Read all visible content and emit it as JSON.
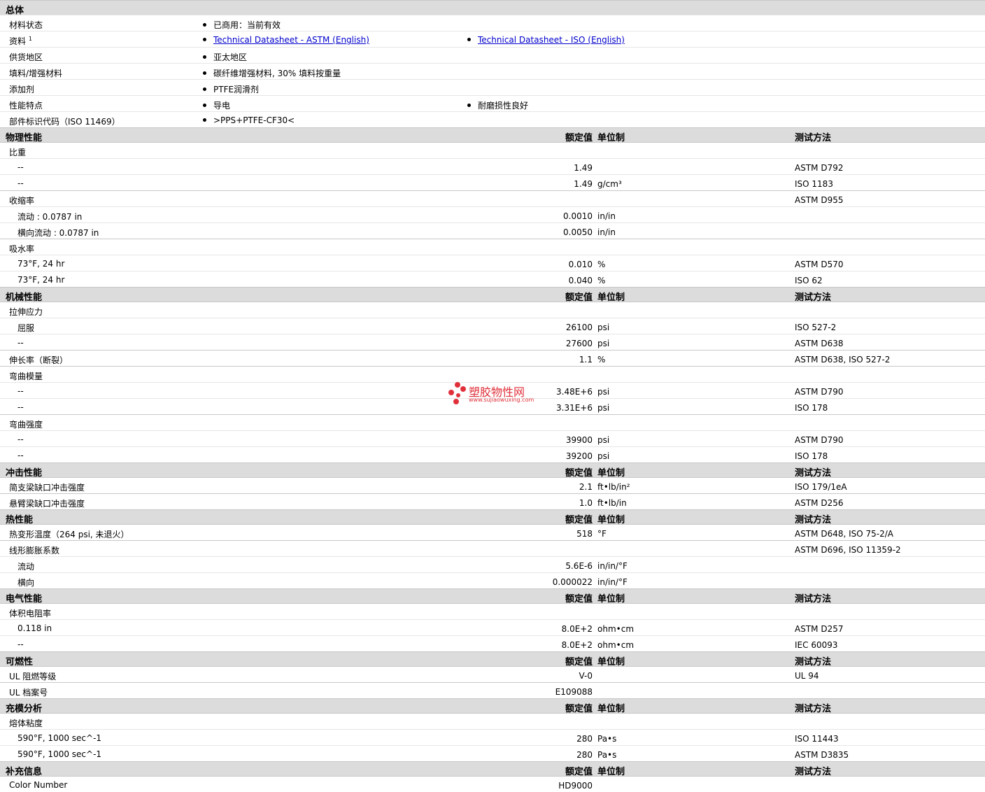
{
  "general": {
    "title": "总体",
    "rows": [
      {
        "label": "材料状态",
        "items": [
          "已商用：当前有效"
        ]
      },
      {
        "label": "资料",
        "sup": "1",
        "items": [
          "Technical Datasheet - ASTM (English)",
          "Technical Datasheet - ISO (English)"
        ],
        "links": true
      },
      {
        "label": "供货地区",
        "items": [
          "亚太地区"
        ]
      },
      {
        "label": "填料/增强材料",
        "items": [
          "碳纤维增强材料, 30% 填料按重量"
        ]
      },
      {
        "label": "添加剂",
        "items": [
          "PTFE润滑剂"
        ]
      },
      {
        "label": "性能特点",
        "items": [
          "导电",
          "耐磨损性良好"
        ]
      },
      {
        "label": "部件标识代码（ISO 11469）",
        "items": [
          ">PPS+PTFE-CF30<"
        ]
      }
    ]
  },
  "column_headers": {
    "value": "额定值",
    "unit": "单位制",
    "method": "测试方法"
  },
  "sections": [
    {
      "title": "物理性能",
      "rows": [
        {
          "type": "grp",
          "label": "比重",
          "value": "",
          "unit": "",
          "method": ""
        },
        {
          "type": "sub",
          "label": "--",
          "value": "1.49",
          "unit": "",
          "method": "ASTM D792"
        },
        {
          "type": "sub",
          "label": "--",
          "value": "1.49",
          "unit": "g/cm³",
          "method": "ISO 1183"
        },
        {
          "type": "grp",
          "label": "收缩率",
          "value": "",
          "unit": "",
          "method": "ASTM D955"
        },
        {
          "type": "sub",
          "label": "流动 : 0.0787 in",
          "value": "0.0010",
          "unit": "in/in",
          "method": ""
        },
        {
          "type": "sub",
          "label": "横向流动 : 0.0787 in",
          "value": "0.0050",
          "unit": "in/in",
          "method": ""
        },
        {
          "type": "grp",
          "label": "吸水率",
          "value": "",
          "unit": "",
          "method": ""
        },
        {
          "type": "sub",
          "label": "73°F, 24 hr",
          "value": "0.010",
          "unit": "%",
          "method": "ASTM D570"
        },
        {
          "type": "sub",
          "label": "73°F, 24 hr",
          "value": "0.040",
          "unit": "%",
          "method": "ISO 62"
        }
      ]
    },
    {
      "title": "机械性能",
      "rows": [
        {
          "type": "grp",
          "label": "拉伸应力",
          "value": "",
          "unit": "",
          "method": ""
        },
        {
          "type": "sub",
          "label": "屈服",
          "value": "26100",
          "unit": "psi",
          "method": "ISO 527-2"
        },
        {
          "type": "sub",
          "label": "--",
          "value": "27600",
          "unit": "psi",
          "method": "ASTM D638"
        },
        {
          "type": "grp",
          "label": "伸长率（断裂）",
          "value": "1.1",
          "unit": "%",
          "method": "ASTM D638, ISO 527-2"
        },
        {
          "type": "grp",
          "label": "弯曲模量",
          "value": "",
          "unit": "",
          "method": ""
        },
        {
          "type": "sub",
          "label": "--",
          "value": "3.48E+6",
          "unit": "psi",
          "method": "ASTM D790"
        },
        {
          "type": "sub",
          "label": "--",
          "value": "3.31E+6",
          "unit": "psi",
          "method": "ISO 178"
        },
        {
          "type": "grp",
          "label": "弯曲强度",
          "value": "",
          "unit": "",
          "method": ""
        },
        {
          "type": "sub",
          "label": "--",
          "value": "39900",
          "unit": "psi",
          "method": "ASTM D790"
        },
        {
          "type": "sub",
          "label": "--",
          "value": "39200",
          "unit": "psi",
          "method": "ISO 178"
        }
      ]
    },
    {
      "title": "冲击性能",
      "rows": [
        {
          "type": "grp",
          "label": "简支梁缺口冲击强度",
          "value": "2.1",
          "unit": "ft•lb/in²",
          "method": "ISO 179/1eA"
        },
        {
          "type": "grp",
          "label": "悬臂梁缺口冲击强度",
          "value": "1.0",
          "unit": "ft•lb/in",
          "method": "ASTM D256"
        }
      ]
    },
    {
      "title": "热性能",
      "rows": [
        {
          "type": "grp",
          "label": "热变形温度（264 psi, 未退火）",
          "value": "518",
          "unit": "°F",
          "method": "ASTM D648, ISO 75-2/A"
        },
        {
          "type": "grp",
          "label": "线形膨胀系数",
          "value": "",
          "unit": "",
          "method": "ASTM D696, ISO 11359-2"
        },
        {
          "type": "sub",
          "label": "流动",
          "value": "5.6E-6",
          "unit": "in/in/°F",
          "method": ""
        },
        {
          "type": "sub",
          "label": "横向",
          "value": "0.000022",
          "unit": "in/in/°F",
          "method": ""
        }
      ]
    },
    {
      "title": "电气性能",
      "rows": [
        {
          "type": "grp",
          "label": "体积电阻率",
          "value": "",
          "unit": "",
          "method": ""
        },
        {
          "type": "sub",
          "label": "0.118 in",
          "value": "8.0E+2",
          "unit": "ohm•cm",
          "method": "ASTM D257"
        },
        {
          "type": "sub",
          "label": "--",
          "value": "8.0E+2",
          "unit": "ohm•cm",
          "method": "IEC 60093"
        }
      ]
    },
    {
      "title": "可燃性",
      "rows": [
        {
          "type": "grp",
          "label": "UL 阻燃等级",
          "value": "V-0",
          "unit": "",
          "method": "UL 94"
        },
        {
          "type": "grp",
          "label": "UL 档案号",
          "value": "E109088",
          "unit": "",
          "method": ""
        }
      ]
    },
    {
      "title": "充模分析",
      "rows": [
        {
          "type": "grp",
          "label": "熔体粘度",
          "value": "",
          "unit": "",
          "method": ""
        },
        {
          "type": "sub",
          "label": "590°F, 1000 sec^-1",
          "value": "280",
          "unit": "Pa•s",
          "method": "ISO 11443"
        },
        {
          "type": "sub",
          "label": "590°F, 1000 sec^-1",
          "value": "280",
          "unit": "Pa•s",
          "method": "ASTM D3835"
        }
      ]
    },
    {
      "title": "补充信息",
      "rows": [
        {
          "type": "grp",
          "label": "Color Number",
          "value": "HD9000",
          "unit": "",
          "method": ""
        }
      ]
    }
  ],
  "watermark": {
    "text_cn": "塑胶物性网",
    "url": "www.sujiaowuxing.com",
    "color": "#e0303a"
  }
}
